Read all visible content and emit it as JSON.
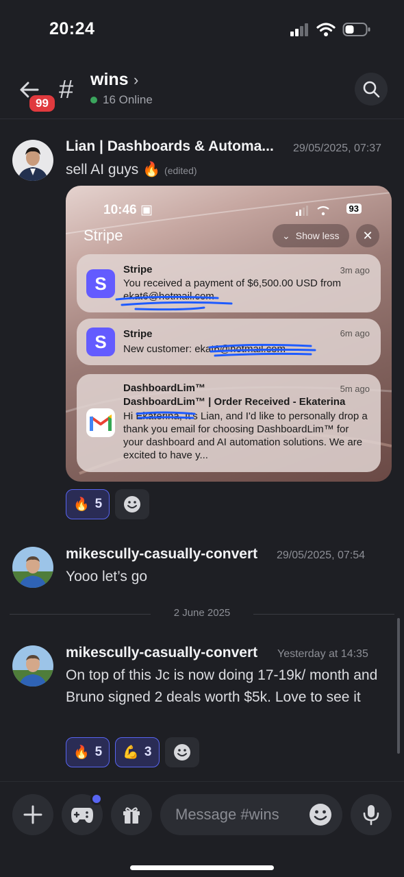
{
  "status_bar": {
    "time": "20:24"
  },
  "header": {
    "unread_badge": "99",
    "channel_name": "wins",
    "chevron": "›",
    "online_text": "16 Online"
  },
  "messages": [
    {
      "author": "Lian | Dashboards & Automa...",
      "time": "29/05/2025, 07:37",
      "text": "sell AI guys 🔥",
      "edited": "(edited)",
      "embed": {
        "time": "10:46",
        "battery": "93",
        "app_title": "Stripe",
        "show_less": "Show less",
        "notifications": [
          {
            "app": "Stripe",
            "time": "3m ago",
            "body": "You received a payment of $6,500.00 USD from ekat6@hotmail.com"
          },
          {
            "app": "Stripe",
            "time": "6m ago",
            "body": "New customer: ekat6@hotmail.com"
          },
          {
            "app": "DashboardLim™",
            "time": "5m ago",
            "subject": "DashboardLim™ | Order Received - Ekaterina",
            "body": "Hi Ekaterina, It's Lian, and I'd like to personally drop a thank you email for choosing DashboardLim™ for your dashboard and AI automation solutions. We are excited to have y..."
          }
        ]
      },
      "reactions": [
        {
          "emoji": "🔥",
          "count": "5"
        }
      ]
    },
    {
      "author": "mikescully-casually-convert",
      "time": "29/05/2025, 07:54",
      "text": "Yooo let’s go"
    },
    {
      "author": "mikescully-casually-convert",
      "time": "Yesterday at 14:35",
      "text": "On top of this Jc is now doing 17-19k/ month and Bruno signed 2 deals worth $5k. Love to see it",
      "reactions": [
        {
          "emoji": "🔥",
          "count": "5"
        },
        {
          "emoji": "💪",
          "count": "3"
        }
      ]
    }
  ],
  "date_divider": "2 June 2025",
  "composer": {
    "placeholder": "Message #wins"
  },
  "colors": {
    "accent": "#5865f2",
    "online": "#3ba55d",
    "badge": "#e03a3e",
    "stripe": "#635bff"
  }
}
